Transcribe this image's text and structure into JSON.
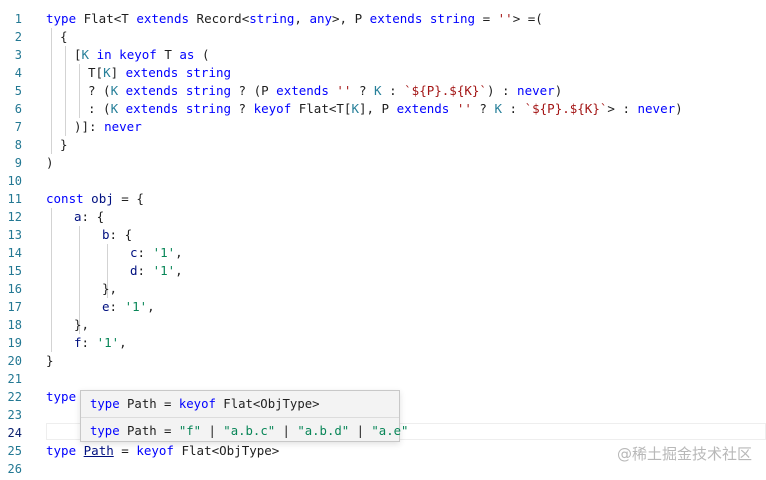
{
  "editor": {
    "line_numbers": [
      "1",
      "2",
      "3",
      "4",
      "5",
      "6",
      "7",
      "8",
      "9",
      "10",
      "11",
      "12",
      "13",
      "14",
      "15",
      "16",
      "17",
      "18",
      "19",
      "20",
      "21",
      "22",
      "23",
      "24",
      "25",
      "26"
    ],
    "active_line": "24"
  },
  "code": {
    "l1": {
      "a": "type",
      "b": " Flat<T ",
      "c": "extends",
      "d": " Record<",
      "e": "string",
      ", ": ", ",
      "f": "any",
      ">, P ": ">, P ",
      "g": "extends",
      "h": " ",
      "i": "string",
      "j": " = ",
      "k": "''",
      "l": "> =("
    },
    "l2": "{",
    "l3": {
      "a": "[",
      "b": "K",
      "c": " in ",
      "d": "keyof",
      "e": " T ",
      "f": "as",
      "g": " ("
    },
    "l4": {
      "a": "T[",
      "b": "K",
      "c": "] ",
      "d": "extends",
      "e": " ",
      "f": "string"
    },
    "l5": {
      "a": "? (",
      "b": "K",
      "c": " ",
      "d": "extends",
      "e": " ",
      "f": "string",
      "g": " ? (P ",
      "h": "extends",
      "i": " ",
      "j": "''",
      "k": " ? ",
      "l": "K",
      "m": " : ",
      "n": "`${P}.${K}`",
      "o": ") : ",
      "p": "never",
      "q": ")"
    },
    "l6": {
      "a": ": (",
      "b": "K",
      "c": " ",
      "d": "extends",
      "e": " ",
      "f": "string",
      "g": " ? ",
      "h": "keyof",
      "i": " Flat<T[",
      "j": "K",
      "k": "], P ",
      "l": "extends",
      "m": " ",
      "n": "''",
      "o": " ? ",
      "p": "K",
      "q": " : ",
      "r": "`${P}.${K}`",
      "s": "> : ",
      "t": "never",
      "u": ")"
    },
    "l7": {
      "a": ")]: ",
      "b": "never"
    },
    "l8": "}",
    "l9": ")",
    "l11": {
      "a": "const",
      "b": " ",
      "c": "obj",
      "d": " = {"
    },
    "l12": {
      "a": "a",
      "b": ": {"
    },
    "l13": {
      "a": "b",
      "b": ": {"
    },
    "l14": {
      "a": "c",
      "b": ": ",
      "c": "'1'",
      "d": ","
    },
    "l15": {
      "a": "d",
      "b": ": ",
      "c": "'1'",
      "d": ","
    },
    "l16": "},",
    "l17": {
      "a": "e",
      "b": ": ",
      "c": "'1'",
      "d": ","
    },
    "l18": "},",
    "l19": {
      "a": "f",
      "b": ": ",
      "c": "'1'",
      "d": ","
    },
    "l20": "}",
    "l22": {
      "a": "type"
    },
    "l25": {
      "a": "type",
      "b": " ",
      "c": "Path",
      "d": " = ",
      "e": "keyof",
      "f": " Flat<ObjType>"
    }
  },
  "hover": {
    "row1": {
      "a": "type",
      "b": " Path = ",
      "c": "keyof",
      "d": " Flat<ObjType>"
    },
    "row2": {
      "a": "type",
      "b": " Path = ",
      "c": "\"f\"",
      "d": " | ",
      "e": "\"a.b.c\"",
      "f": " | ",
      "g": "\"a.b.d\"",
      "h": " | ",
      "i": "\"a.e\""
    }
  },
  "watermark": "@稀土掘金技术社区"
}
